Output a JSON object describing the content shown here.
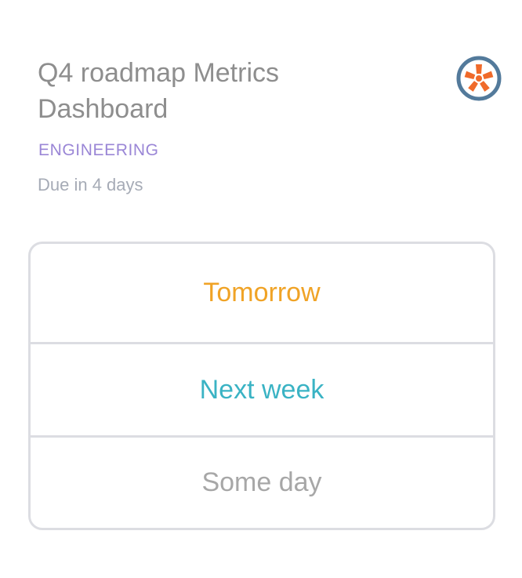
{
  "task": {
    "title": "Q4 roadmap Metrics Dashboard",
    "category": "ENGINEERING",
    "due": "Due in 4 days"
  },
  "avatar": {
    "icon": "orange-asterisk-logo-icon",
    "ring_color": "#537a9b",
    "fill_color": "#f06a2a"
  },
  "options": [
    {
      "label": "Tomorrow",
      "color": "#f0a326"
    },
    {
      "label": "Next week",
      "color": "#3ab3c4"
    },
    {
      "label": "Some day",
      "color": "#a7a7a7"
    }
  ]
}
